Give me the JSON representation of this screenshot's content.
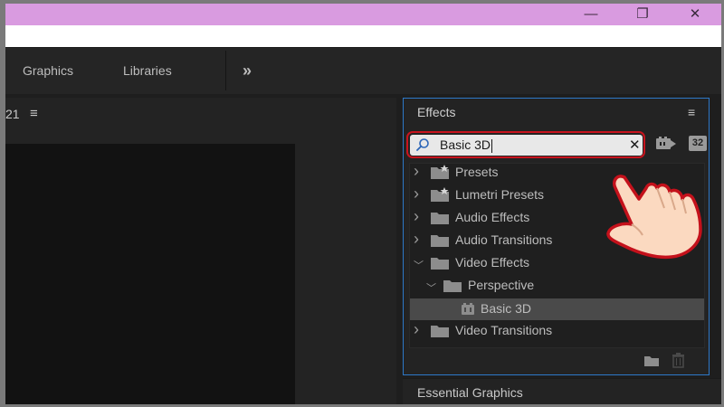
{
  "window": {
    "controls": {
      "minimize_icon": "—",
      "restore_icon": "❐",
      "close_icon": "✕"
    }
  },
  "workspace_tabs": [
    {
      "label": "Graphics"
    },
    {
      "label": "Libraries"
    }
  ],
  "workspace_overflow_icon": "»",
  "left_panel": {
    "timecode_fragment": "21",
    "menu_icon": "≡"
  },
  "effects_panel": {
    "title": "Effects",
    "menu_icon": "≡",
    "search": {
      "value": "Basic 3D",
      "clear_icon": "✕"
    },
    "toolbar_badge_32": "32",
    "tree": [
      {
        "label": "Presets",
        "expanded": false,
        "level": 0,
        "type": "preset-folder"
      },
      {
        "label": "Lumetri Presets",
        "expanded": false,
        "level": 0,
        "type": "preset-folder"
      },
      {
        "label": "Audio Effects",
        "expanded": false,
        "level": 0,
        "type": "folder"
      },
      {
        "label": "Audio Transitions",
        "expanded": false,
        "level": 0,
        "type": "folder"
      },
      {
        "label": "Video Effects",
        "expanded": true,
        "level": 0,
        "type": "folder"
      },
      {
        "label": "Perspective",
        "expanded": true,
        "level": 1,
        "type": "folder"
      },
      {
        "label": "Basic 3D",
        "level": 2,
        "type": "effect",
        "selected": true
      },
      {
        "label": "Video Transitions",
        "expanded": false,
        "level": 0,
        "type": "folder"
      }
    ]
  },
  "essential_graphics": {
    "title": "Essential Graphics"
  },
  "colors": {
    "highlight_red": "#c8141e",
    "panel_focus_blue": "#2d78c8",
    "titlebar": "#d99be0"
  }
}
